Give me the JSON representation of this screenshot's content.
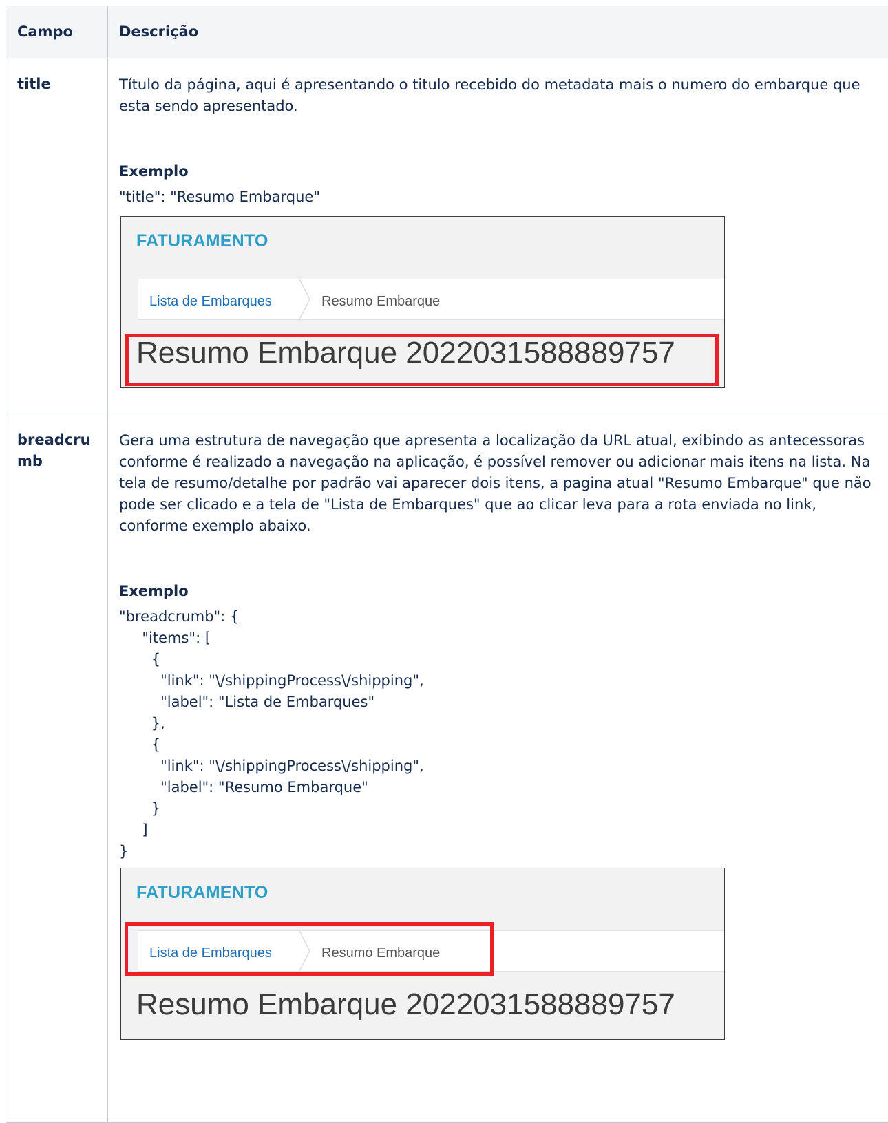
{
  "table": {
    "headers": {
      "field": "Campo",
      "description": "Descrição"
    },
    "rows": [
      {
        "field": "title",
        "description": "Título da página, aqui é apresentando o titulo recebido do metadata mais o numero do embarque que esta sendo apresentado.",
        "example_heading": "Exemplo",
        "example_code": "\"title\": \"Resumo Embarque\""
      },
      {
        "field": "breadcrumb",
        "description": "Gera uma estrutura de navegação que apresenta a localização da URL atual, exibindo as antecessoras conforme é realizado a navegação na aplicação, é possível remover ou adicionar mais itens na lista. Na tela de resumo/detalhe por padrão vai aparecer dois itens, a pagina atual \"Resumo Embarque\" que não pode ser clicado e a tela de \"Lista de Embarques\" que ao clicar leva para a rota enviada no link, conforme exemplo abaixo.",
        "example_heading": "Exemplo",
        "example_code": "\"breadcrumb\": {\n     \"items\": [\n       {\n         \"link\": \"\\/shippingProcess\\/shipping\",\n         \"label\": \"Lista de Embarques\"\n       },\n       {\n         \"link\": \"\\/shippingProcess\\/shipping\",\n         \"label\": \"Resumo Embarque\"\n       }\n     ]\n}"
      }
    ]
  },
  "screenshot": {
    "module": "FATURAMENTO",
    "crumb_1": "Lista de Embarques",
    "crumb_2": "Resumo Embarque",
    "page_title": "Resumo Embarque 2022031588889757",
    "highlight_color": "#e8202a",
    "module_color": "#2e9fc6",
    "link_color": "#1f6fb5"
  }
}
